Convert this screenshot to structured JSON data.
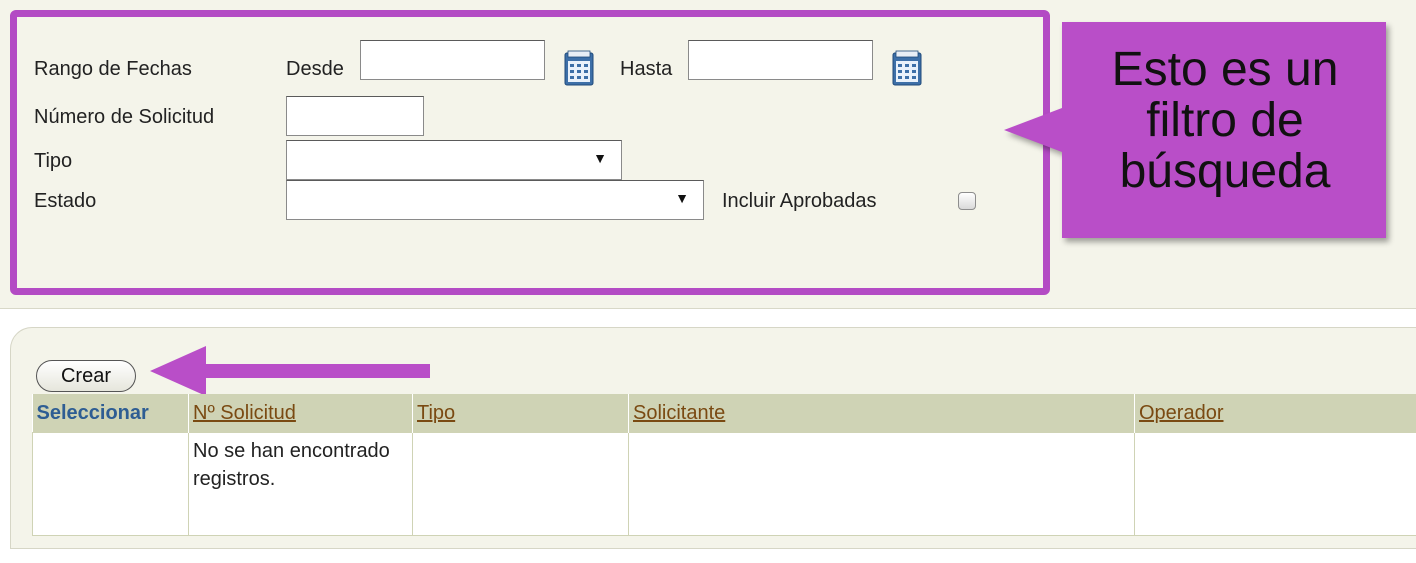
{
  "filter": {
    "date_range_label": "Rango de Fechas",
    "from_label": "Desde",
    "from_value": "",
    "to_label": "Hasta",
    "to_value": "",
    "request_number_label": "Número de Solicitud",
    "request_number_value": "",
    "type_label": "Tipo",
    "type_value": "",
    "status_label": "Estado",
    "status_value": "",
    "include_approved_label": "Incluir Aprobadas",
    "include_approved_checked": false,
    "highlight_color": "#b34bc4"
  },
  "callout": {
    "line1": "Esto es un",
    "line2": "filtro de",
    "line3": "búsqueda",
    "color": "#b94ec8"
  },
  "results": {
    "create_label": "Crear",
    "columns": [
      "Seleccionar",
      "Nº Solicitud",
      "Tipo",
      "Solicitante",
      "Operador"
    ],
    "empty_message": "No se han encontrado registros."
  },
  "icons": {
    "calendar": "calendar-icon",
    "dropdown": "dropdown-arrow-icon",
    "arrow": "pointer-arrow-icon"
  },
  "colors": {
    "panel_bg": "#f4f4ea",
    "header_bg": "#cfd3b5",
    "link_color": "#7a4a12",
    "select_header_color": "#2e5d93"
  }
}
